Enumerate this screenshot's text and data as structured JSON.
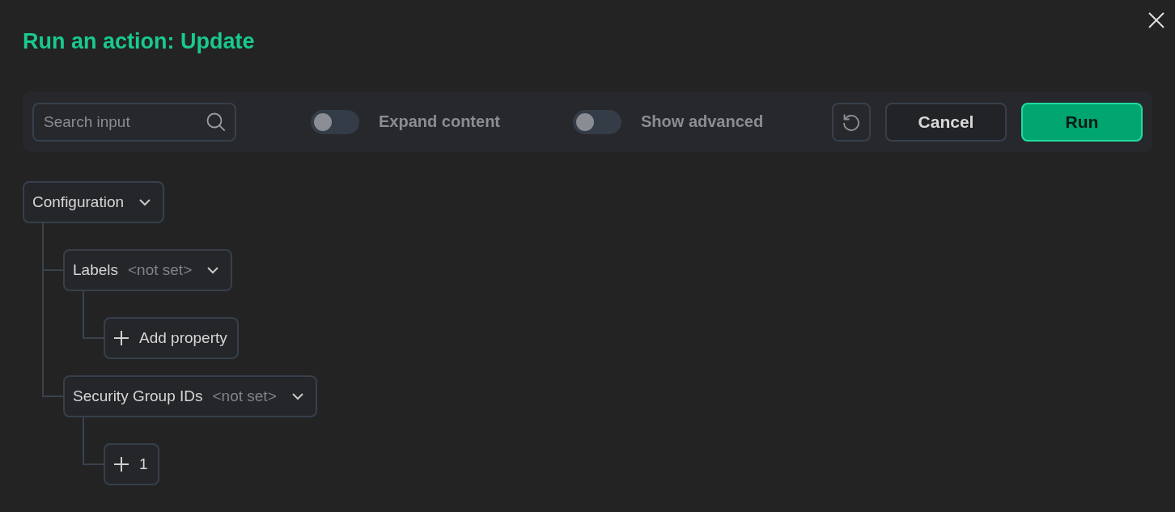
{
  "dialog": {
    "title": "Run an action: Update"
  },
  "toolbar": {
    "search": {
      "placeholder": "Search input"
    },
    "toggles": [
      {
        "label": "Expand content",
        "on": false
      },
      {
        "label": "Show advanced",
        "on": false
      }
    ],
    "buttons": [
      {
        "kind": "secondary",
        "label": "Cancel"
      },
      {
        "kind": "primary",
        "label": "Run"
      }
    ]
  },
  "tree": [
    {
      "kind": "group",
      "label": "Configuration",
      "expanded": true,
      "children": [
        {
          "kind": "group",
          "label": "Labels",
          "value": "<not set>",
          "expanded": true,
          "children": [
            {
              "kind": "add",
              "label": "Add property"
            }
          ]
        },
        {
          "kind": "group",
          "label": "Security Group IDs",
          "value": "<not set>",
          "expanded": true,
          "children": [
            {
              "kind": "add",
              "label": "1"
            }
          ]
        }
      ]
    }
  ]
}
